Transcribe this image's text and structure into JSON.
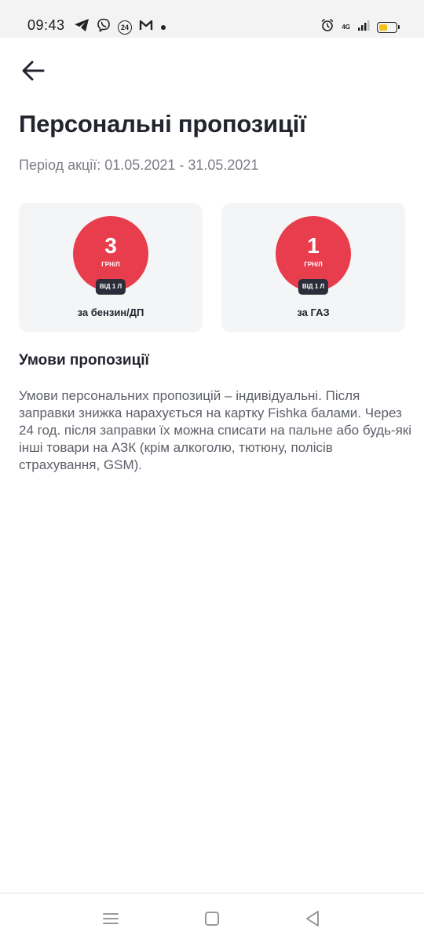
{
  "status_bar": {
    "time": "09:43",
    "badge_24": "24",
    "network_label": "4G"
  },
  "header": {
    "back_icon": "arrow-left-icon"
  },
  "page": {
    "title": "Персональні пропозиції",
    "period": "Період акції: 01.05.2021 - 31.05.2021"
  },
  "offers": [
    {
      "value": "3",
      "unit": "ГРН/Л",
      "min": "ВІД 1 Л",
      "label": "за бензин/ДП"
    },
    {
      "value": "1",
      "unit": "ГРН/Л",
      "min": "ВІД 1 Л",
      "label": "за ГАЗ"
    }
  ],
  "conditions": {
    "title": "Умови пропозиції",
    "body": "Умови персональних пропозицій – індивідуальні. Після заправки знижка нарахується на картку Fishka балами. Через 24 год. після заправки їх можна списати на пальне або будь-які інші товари на АЗК (крім алкоголю, тютюну, полісів страхування, GSM)."
  },
  "colors": {
    "accent_red": "#e83d4c",
    "dark": "#23252e",
    "card_bg": "#f4f5f7",
    "battery": "#f2c21b"
  },
  "nav": {
    "icons": [
      "menu-icon",
      "home-square-icon",
      "back-triangle-icon"
    ]
  }
}
